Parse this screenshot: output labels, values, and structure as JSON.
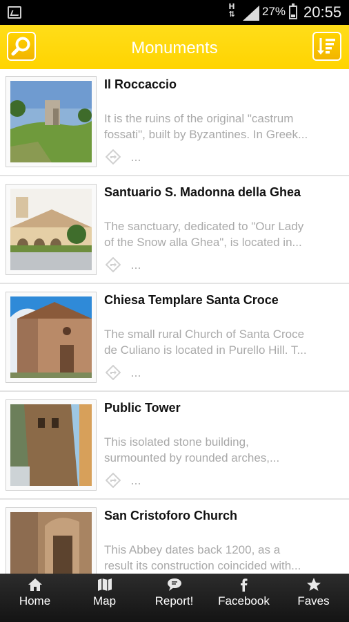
{
  "status_bar": {
    "network": "H",
    "battery_pct": "27%",
    "battery_level": 0.27,
    "time": "20:55"
  },
  "top_bar": {
    "title": "Monuments"
  },
  "items": [
    {
      "name": "Il Roccaccio",
      "desc_line1": "It is the ruins of the original \"castrum",
      "desc_line2": "fossati\", built by Byzantines. In Greek...",
      "more": "..."
    },
    {
      "name": "Santuario S. Madonna della Ghea",
      "desc_line1": "The sanctuary, dedicated to \"Our Lady",
      "desc_line2": "of the Snow alla Ghea\", is located in...",
      "more": "..."
    },
    {
      "name": "Chiesa Templare Santa Croce",
      "desc_line1": "The small rural Church of Santa Croce",
      "desc_line2": "de Culiano is located in Purello Hill. T...",
      "more": "..."
    },
    {
      "name": "Public Tower",
      "desc_line1": "This isolated stone building,",
      "desc_line2": "surmounted by rounded arches,...",
      "more": "..."
    },
    {
      "name": "San Cristoforo Church",
      "desc_line1": "This Abbey dates back 1200, as a",
      "desc_line2": "result its construction coincided with...",
      "more": "..."
    }
  ],
  "bottom_nav": [
    {
      "label": "Home",
      "icon": "home-icon"
    },
    {
      "label": "Map",
      "icon": "map-icon"
    },
    {
      "label": "Report!",
      "icon": "chat-icon"
    },
    {
      "label": "Facebook",
      "icon": "facebook-icon"
    },
    {
      "label": "Faves",
      "icon": "star-icon"
    }
  ],
  "colors": {
    "accent": "#ffd400",
    "nav_bg": "#1e1e1e",
    "desc_text": "#a9a9a9"
  }
}
